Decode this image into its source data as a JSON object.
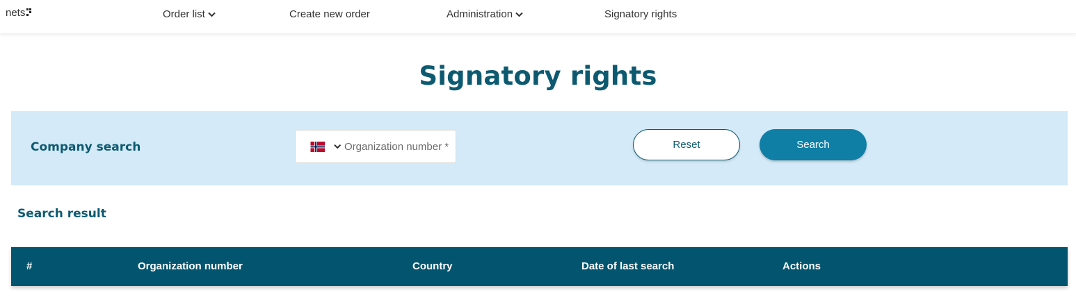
{
  "brand": {
    "logo_text": "nets"
  },
  "nav": {
    "order_list": "Order list",
    "create_new_order": "Create new order",
    "administration": "Administration",
    "signatory_rights": "Signatory rights"
  },
  "page": {
    "title": "Signatory rights"
  },
  "company_search": {
    "label": "Company search",
    "country_flag": "norway-flag-icon",
    "org_number_placeholder": "Organization number *",
    "org_number_value": "",
    "reset_label": "Reset",
    "search_label": "Search"
  },
  "results": {
    "label": "Search result",
    "columns": [
      "#",
      "Organization number",
      "Country",
      "Date of last search",
      "Actions"
    ],
    "rows": []
  },
  "colors": {
    "primary_dark": "#0d5a70",
    "table_header": "#03556f",
    "search_button": "#0f7fa6",
    "panel_bg": "#d4eaf8"
  }
}
